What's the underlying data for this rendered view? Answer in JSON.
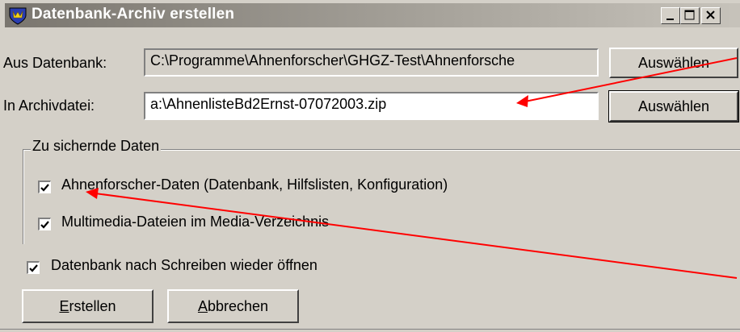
{
  "window": {
    "title": "Datenbank-Archiv erstellen",
    "controls": [
      "minimize",
      "maximize",
      "close"
    ]
  },
  "source": {
    "label": "Aus Datenbank:",
    "value": "C:\\Programme\\Ahnenforscher\\GHGZ-Test\\Ahnenforsche",
    "button_label": "Auswählen"
  },
  "archive": {
    "label": "In Archivdatei:",
    "value": "a:\\AhnenlisteBd2Ernst-07072003.zip",
    "button_label": "Auswählen"
  },
  "group": {
    "title": "Zu sichernde Daten",
    "options": [
      {
        "label": "Ahnenforscher-Daten (Datenbank, Hilfslisten, Konfiguration)",
        "checked": true
      },
      {
        "label": "Multimedia-Dateien im Media-Verzeichnis",
        "checked": true
      }
    ]
  },
  "reopen": {
    "label": "Datenbank nach Schreiben wieder öffnen",
    "checked": true
  },
  "actions": {
    "create_label": "Erstellen",
    "cancel_label": "Abbrechen"
  },
  "colors": {
    "annotation_arrow": "#ff0000",
    "dialog_bg": "#d4d0c8"
  },
  "icons": {
    "app": "shield-crest-icon"
  }
}
